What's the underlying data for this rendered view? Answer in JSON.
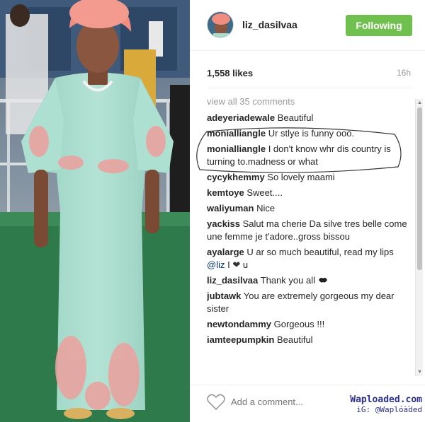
{
  "post": {
    "username": "liz_dasilvaa",
    "follow_label": "Following",
    "likes": "1,558 likes",
    "time_ago": "16h",
    "view_all": "view all 35 comments",
    "add_comment_placeholder": "Add a comment..."
  },
  "comments": [
    {
      "user": "adeyeriadewale",
      "text": "Beautiful"
    },
    {
      "user": "monialliangle",
      "text": "Ur stlye is funny ooo."
    },
    {
      "user": "monialliangle",
      "text": "I don't know whr dis country is turning to.madness or what"
    },
    {
      "user": "cycykhemmy",
      "text": "So lovely maami"
    },
    {
      "user": "kemtoye",
      "text": "Sweet...."
    },
    {
      "user": "waliyuman",
      "text": "Nice"
    },
    {
      "user": "yackiss",
      "text": "Salut ma cherie Da silve tres belle come une femme je t'adore..gross bissou"
    },
    {
      "user": "ayalarge",
      "text_before": "U ar so much beautiful, read my lips",
      "mention": "@liz",
      "text_after": "I",
      "emoji": "heart",
      "text_end": "u"
    },
    {
      "user": "liz_dasilvaa",
      "text": "Thank you all",
      "emoji": "kiss-lips"
    },
    {
      "user": "jubtawk",
      "text": "You are extremely gorgeous my dear sister"
    },
    {
      "user": "newtondammy",
      "text": "Gorgeous !!!"
    },
    {
      "user": "iamteepumpkin",
      "text": "Beautiful"
    }
  ],
  "watermark": {
    "main": "Waploaded.com",
    "sub": "iG: @Waploaded"
  },
  "icons": {
    "like": "heart-outline-icon",
    "more": "ellipsis-icon"
  },
  "colors": {
    "follow_button": "#70c050",
    "highlight_oval": "#333333",
    "dress": "#a8dccc",
    "gele": "#f08c80"
  }
}
